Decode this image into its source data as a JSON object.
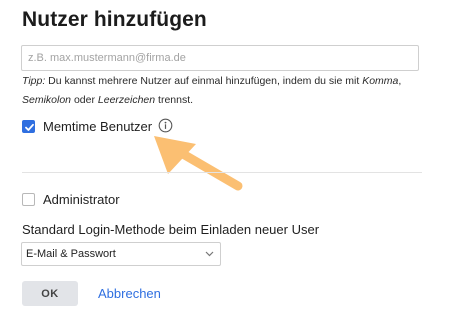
{
  "dialog": {
    "title": "Nutzer hinzufügen"
  },
  "email_input": {
    "value": "",
    "placeholder": "z.B. max.mustermann@firma.de"
  },
  "tip": {
    "prefix": "Tipp:",
    "text1": " Du kannst mehrere Nutzer auf einmal hinzufügen, indem du sie mit ",
    "sep1": "Komma",
    "comma": ",",
    "sep2": "Semikolon",
    "text2": " oder ",
    "sep3": "Leerzeichen",
    "text3": " trennst."
  },
  "memtime_user": {
    "label": "Memtime Benutzer",
    "checked": true
  },
  "admin": {
    "label": "Administrator",
    "checked": false
  },
  "login_method": {
    "label": "Standard Login-Methode beim Einladen neuer User",
    "selected": "E-Mail & Passwort"
  },
  "actions": {
    "ok_label": "OK",
    "cancel_label": "Abbrechen"
  },
  "icons": {
    "info": "info-icon",
    "checkmark": "checkmark-icon",
    "chevron": "chevron-down-icon",
    "arrow": "pointer-arrow"
  },
  "colors": {
    "accent": "#2f6fe0",
    "arrow": "#fbbf72",
    "button_bg": "#e2e4e8"
  }
}
